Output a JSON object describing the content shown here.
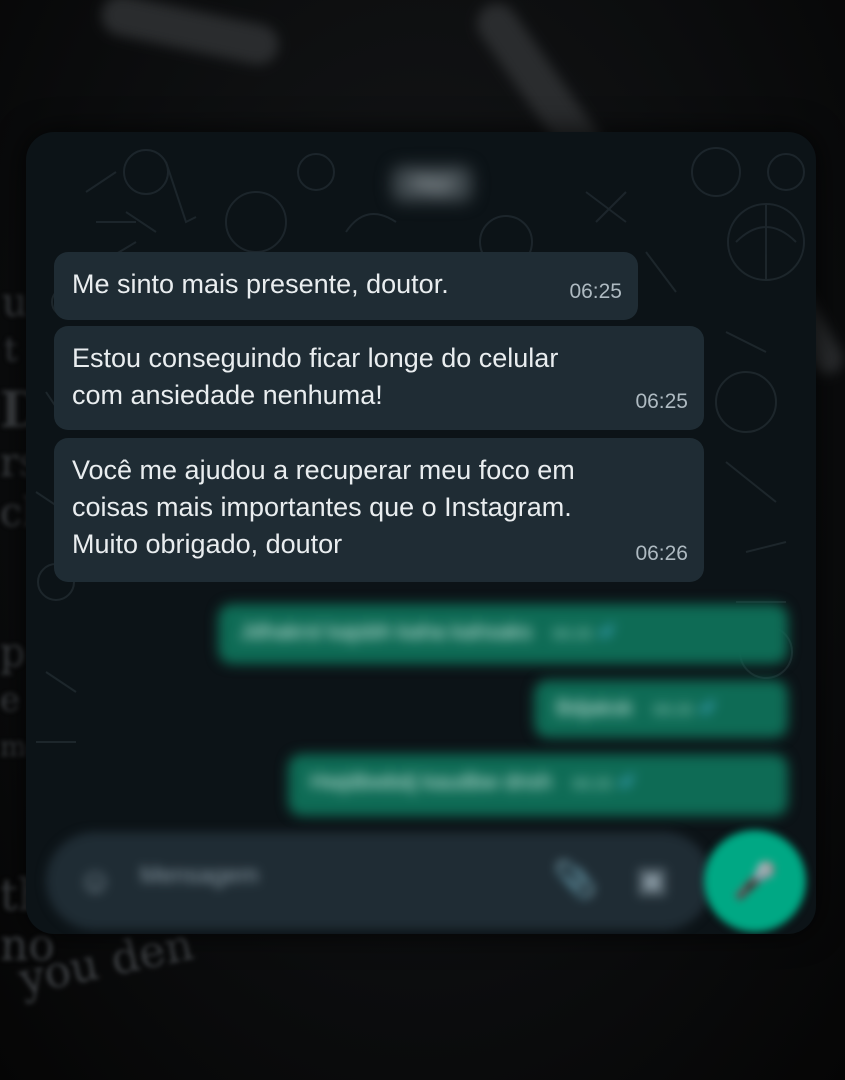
{
  "background": {
    "fragments": [
      "u",
      "t",
      "D",
      "rs",
      "ch",
      "p",
      "e",
      "me",
      "th",
      "no",
      "you den"
    ]
  },
  "chat": {
    "contact_name": "Heyl",
    "incoming": [
      {
        "lines": [
          "Me sinto mais presente, doutor."
        ],
        "time": "06:25"
      },
      {
        "lines": [
          "Estou conseguindo ficar longe do celular",
          "com ansiedade nenhuma!"
        ],
        "time": "06:25"
      },
      {
        "lines": [
          "Você me ajudou a recuperar meu foco em",
          "coisas mais importantes que o Instagram.",
          "Muito obrigado, doutor"
        ],
        "time": "06:26"
      }
    ],
    "outgoing": [
      {
        "text": "Jdhakrsl kajsbh kaha kahsaks",
        "time": "06:26",
        "tick": "✔"
      },
      {
        "text": "Bdjaksk",
        "time": "06:26",
        "tick": "✔"
      },
      {
        "text": "Hwjdbwbdj kaudbw dnsh",
        "time": "06:26",
        "tick": "✔"
      }
    ],
    "composer": {
      "placeholder": "Mensagem",
      "emoji_icon": "☺",
      "attach_icon": "📎",
      "camera_icon": "▣",
      "mic_icon": "🎤"
    }
  },
  "colors": {
    "incoming_bubble": "#1f2c34",
    "outgoing_bubble": "#0e6b55",
    "accent": "#00a884",
    "chat_bg": "#0c1317"
  }
}
